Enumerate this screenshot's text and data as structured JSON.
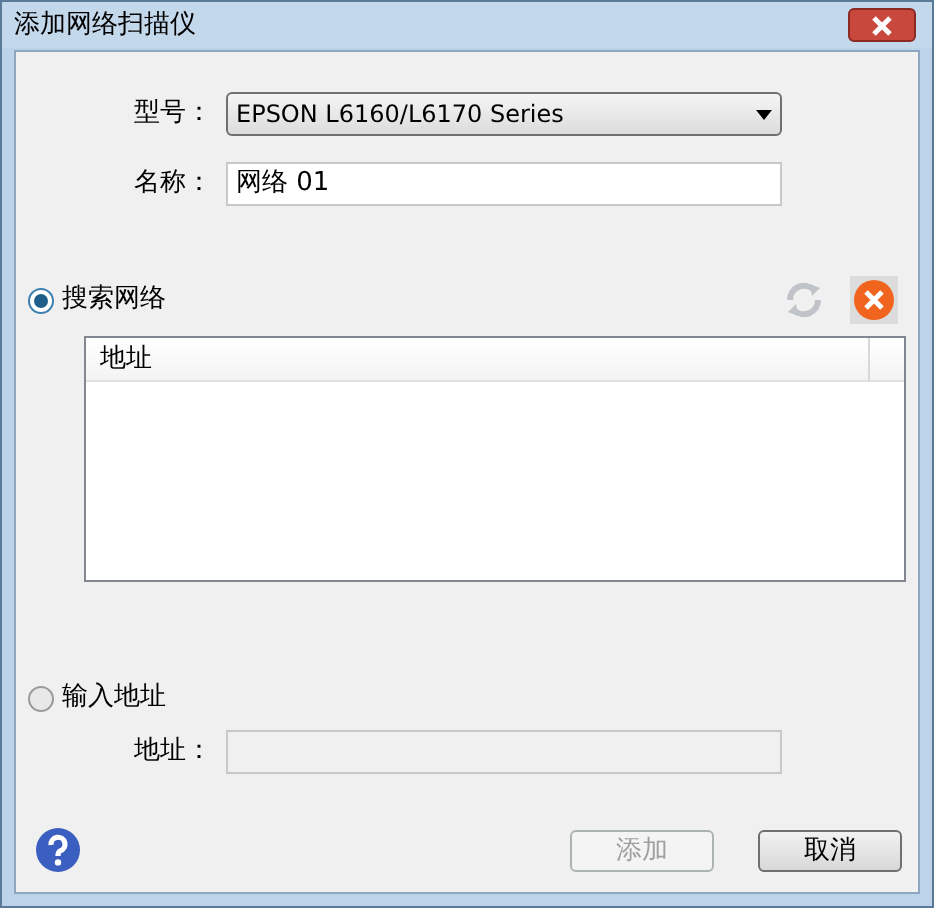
{
  "window": {
    "title": "添加网络扫描仪"
  },
  "model": {
    "label": "型号：",
    "value": "EPSON L6160/L6170 Series"
  },
  "name": {
    "label": "名称：",
    "value": "网络 01"
  },
  "modes": [
    {
      "label": "搜索网络",
      "selected": true
    },
    {
      "label": "输入地址",
      "selected": false
    }
  ],
  "list": {
    "columns": [
      "地址"
    ]
  },
  "address": {
    "label": "地址：",
    "disabled": true
  },
  "buttons": [
    {
      "label": "添加",
      "disabled": true
    },
    {
      "label": "取消",
      "disabled": false
    }
  ]
}
